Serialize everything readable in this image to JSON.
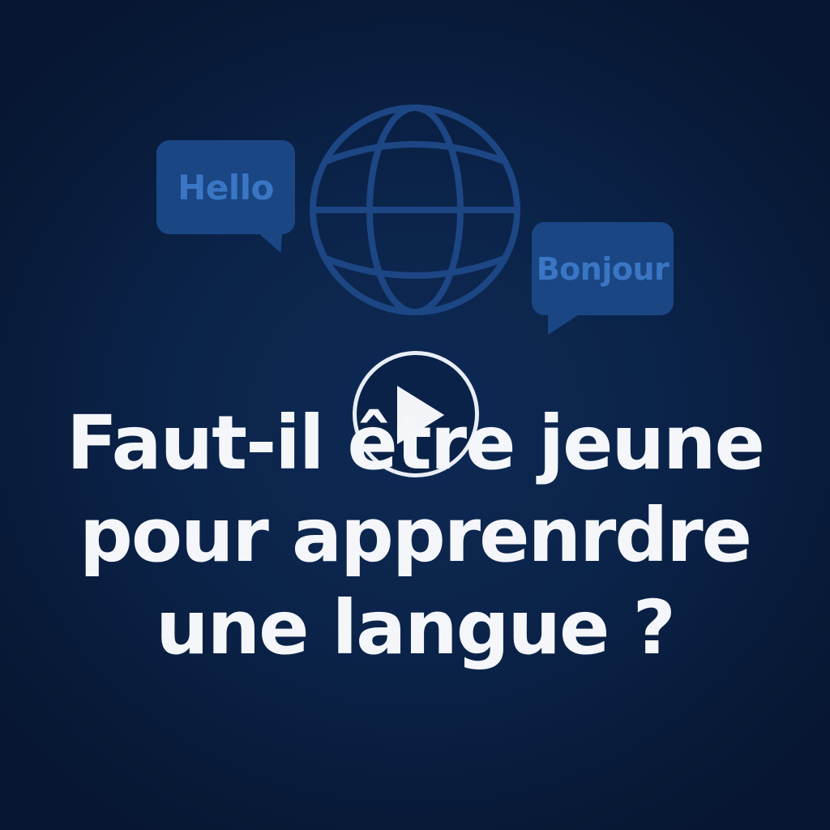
{
  "bubbles": {
    "hello": "Hello",
    "bonjour": "Bonjour"
  },
  "headline": {
    "line1": "Faut-il être jeune",
    "line2": "pour apprenrdre",
    "line3": "une langue ?"
  },
  "icons": {
    "globe": "globe-icon",
    "play": "play-icon"
  },
  "colors": {
    "background": "#0b2349",
    "bubble": "#1a4684",
    "bubble_text": "#3a76c4",
    "globe_stroke": "#1d4684",
    "headline": "#f4f6fa",
    "play": "#e9eef6"
  }
}
